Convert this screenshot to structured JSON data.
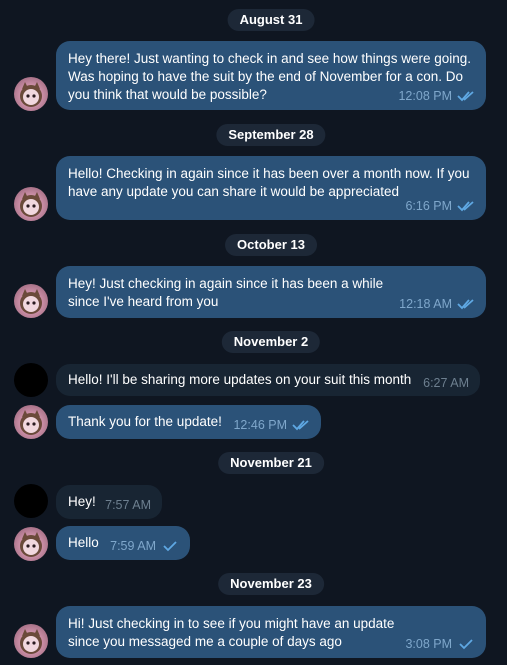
{
  "colors": {
    "background": "#0f1621",
    "outgoing_bubble": "#2b5278",
    "incoming_bubble": "#182533",
    "date_pill": "#1d2837",
    "check_color": "#5fa8e3"
  },
  "dates": [
    "August 31",
    "September 28",
    "October 13",
    "November 2",
    "November 21",
    "November 23"
  ],
  "messages": [
    {
      "direction": "out",
      "text": "Hey there! Just wanting to check in and see how things were going. Was hoping to have the suit by the end of November for a con. Do you think that would be possible?",
      "time": "12:08 PM",
      "status": "read"
    },
    {
      "direction": "out",
      "text": "Hello! Checking in again since it has been over a month now. If you have any update you can share it would be appreciated",
      "time": "6:16 PM",
      "status": "read"
    },
    {
      "direction": "out",
      "text": "Hey! Just checking in again since it has been a while since I've heard from you",
      "time": "12:18 AM",
      "status": "read"
    },
    {
      "direction": "in",
      "text": "Hello! I'll be sharing more updates on your suit this month",
      "time": "6:27 AM"
    },
    {
      "direction": "out",
      "text": "Thank you for the update!",
      "time": "12:46 PM",
      "status": "read"
    },
    {
      "direction": "in",
      "text": "Hey!",
      "time": "7:57 AM"
    },
    {
      "direction": "out",
      "text": "Hello",
      "time": "7:59 AM",
      "status": "sent"
    },
    {
      "direction": "out",
      "text": "Hi! Just checking in to see if you might have an update since you messaged me a couple of days ago",
      "time": "3:08 PM",
      "status": "sent"
    }
  ]
}
